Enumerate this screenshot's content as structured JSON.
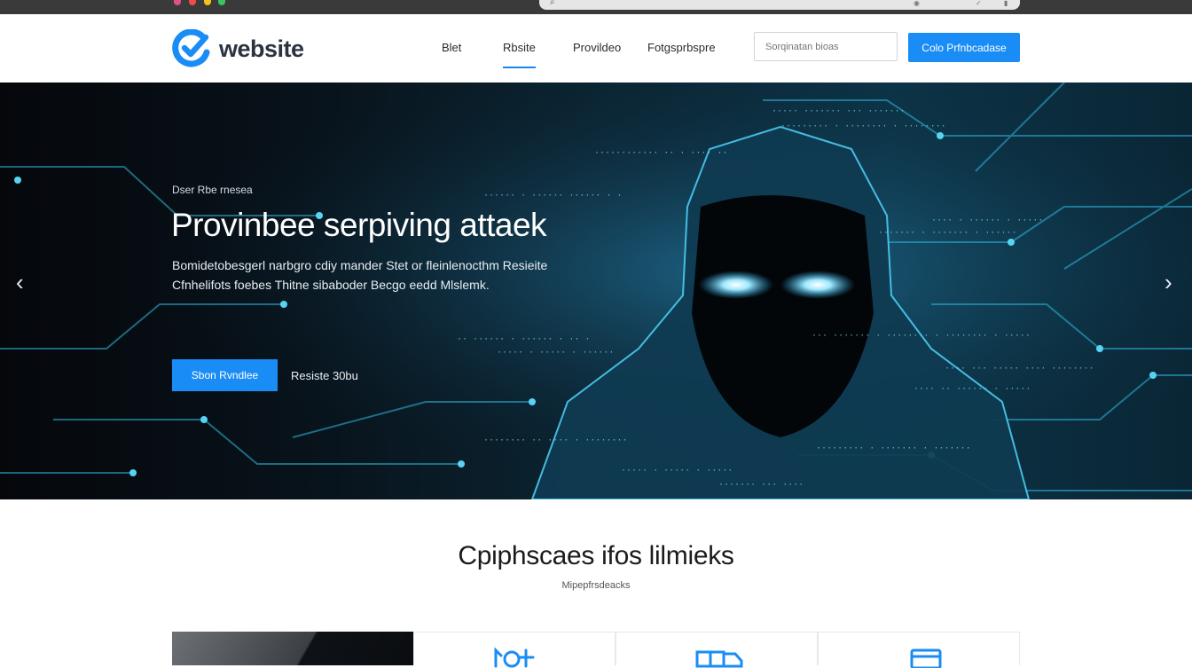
{
  "header": {
    "logo_text": "website",
    "nav": [
      {
        "label": "Blet",
        "active": false
      },
      {
        "label": "Rbsite",
        "active": true
      },
      {
        "label": "Provildeo",
        "active": false
      },
      {
        "label": "Fotgsprbspre",
        "active": false
      }
    ],
    "search_placeholder": "Sorqinatan bioas",
    "cta_label": "Colo Prfnbcadase"
  },
  "hero": {
    "eyebrow": "Dser Rbe rnesea",
    "title": "Provinbee serpiving attaek",
    "description": "Bomidetobesgerl narbgro cdiy mander Stet or fleinlenocthm Resieite Cfnhelifots foebes Thitne sibaboder Becgo eedd Mlslemk.",
    "primary_button": "Sbon Rvndlee",
    "secondary_link": "Resiste 30bu",
    "accent_color": "#1a8cf5"
  },
  "section": {
    "title": "Cpiphscaes  ifos lilmieks",
    "subtitle": "Mipepfrsdeacks"
  },
  "icons": {
    "logo": "check-circle-icon",
    "prev": "chevron-left-icon",
    "next": "chevron-right-icon",
    "search": "search-icon"
  }
}
